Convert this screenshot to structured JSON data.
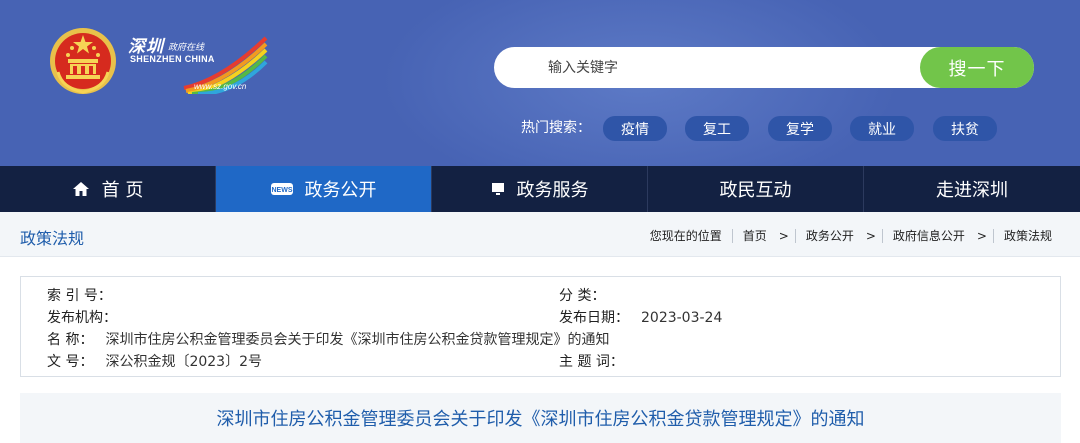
{
  "header": {
    "logo": {
      "cn_text": "深圳",
      "cn_small": "政府在线",
      "en_text": "SHENZHEN CHINA",
      "url": "www.sz.gov.cn"
    },
    "search": {
      "placeholder": "输入关键字",
      "button_label": "搜一下"
    },
    "hot_search": {
      "label": "热门搜索：",
      "tags": [
        "疫情",
        "复工",
        "复学",
        "就业",
        "扶贫"
      ]
    },
    "colors": {
      "header_bg": "#4763b4",
      "search_button": "#72c54a",
      "tag_bg": "#2f55a8"
    }
  },
  "nav": {
    "items": [
      {
        "label": "首 页",
        "icon": "home-icon"
      },
      {
        "label": "政务公开",
        "icon": "news-icon"
      },
      {
        "label": "政务服务",
        "icon": "monitor-icon"
      },
      {
        "label": "政民互动",
        "icon": ""
      },
      {
        "label": "走进深圳",
        "icon": ""
      }
    ],
    "active_index": 1,
    "colors": {
      "bg": "#132142",
      "active": "#1f68c6"
    }
  },
  "breadcrumb": {
    "section_title": "政策法规",
    "location_label": "您现在的位置",
    "items": [
      "首页",
      "政务公开",
      "政府信息公开",
      "政策法规"
    ]
  },
  "info": {
    "index_label": "索 引 号：",
    "index_value": "",
    "category_label": "分  类：",
    "category_value": "",
    "issuer_label": "发布机构：",
    "issuer_value": "",
    "date_label": "发布日期：",
    "date_value": "2023-03-24",
    "name_label": "名  称：",
    "name_value": "深圳市住房公积金管理委员会关于印发《深圳市住房公积金贷款管理规定》的通知",
    "docno_label": "文  号：",
    "docno_value": "深公积金规〔2023〕2号",
    "keywords_label": "主 题 词：",
    "keywords_value": ""
  },
  "document": {
    "title": "深圳市住房公积金管理委员会关于印发《深圳市住房公积金贷款管理规定》的通知"
  }
}
